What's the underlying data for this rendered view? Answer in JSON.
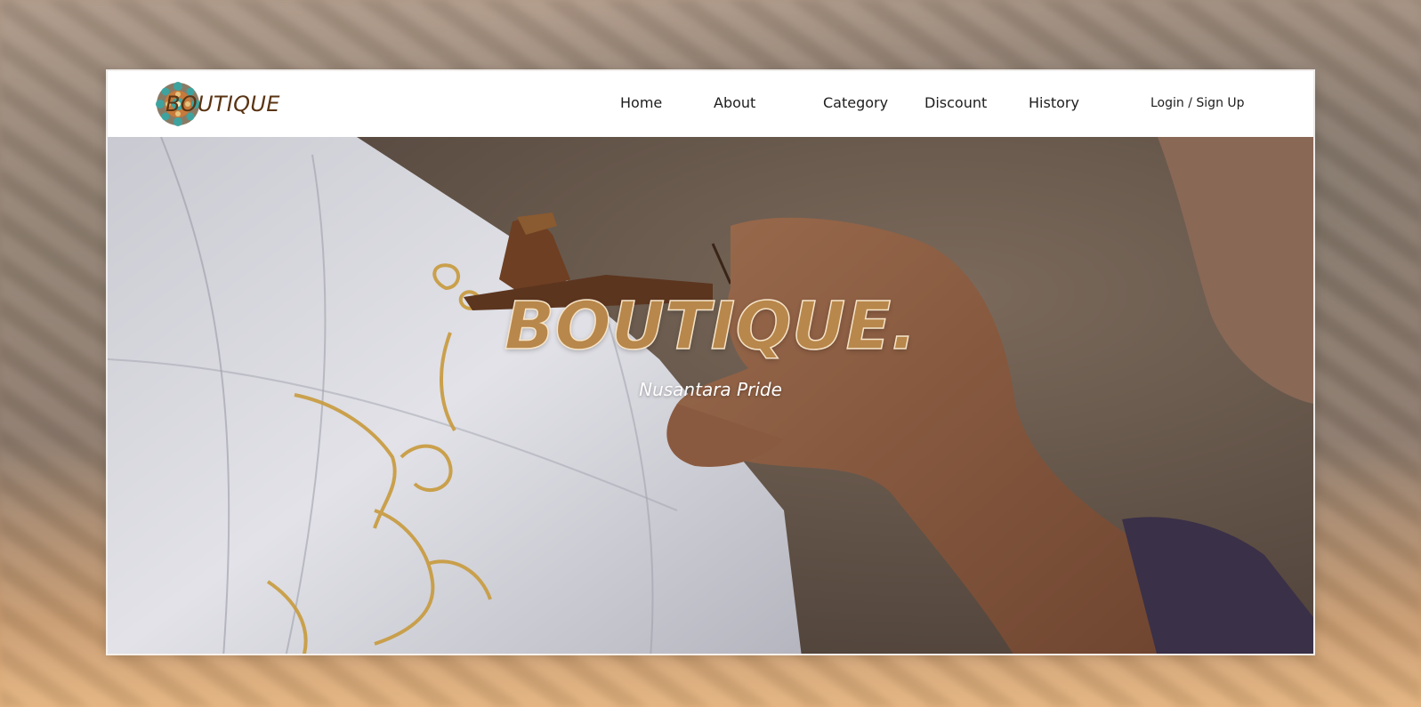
{
  "brand": {
    "name": "BOUTIQUE",
    "logo_icon": "mandala-icon"
  },
  "nav": {
    "items": [
      {
        "label": "Home"
      },
      {
        "label": "About"
      },
      {
        "label": "Category"
      },
      {
        "label": "Discount"
      },
      {
        "label": "History"
      }
    ]
  },
  "auth": {
    "login_label": "Login",
    "separator": " / ",
    "signup_label": "Sign Up"
  },
  "hero": {
    "title": "BOUTIQUE.",
    "subtitle": "Nusantara Pride",
    "image_subject": "batik-canting-image"
  },
  "colors": {
    "brand_text": "#5a3413",
    "title_fill": "#b8874b",
    "title_stroke": "#f6e4c9",
    "navbar_bg": "#ffffff"
  }
}
